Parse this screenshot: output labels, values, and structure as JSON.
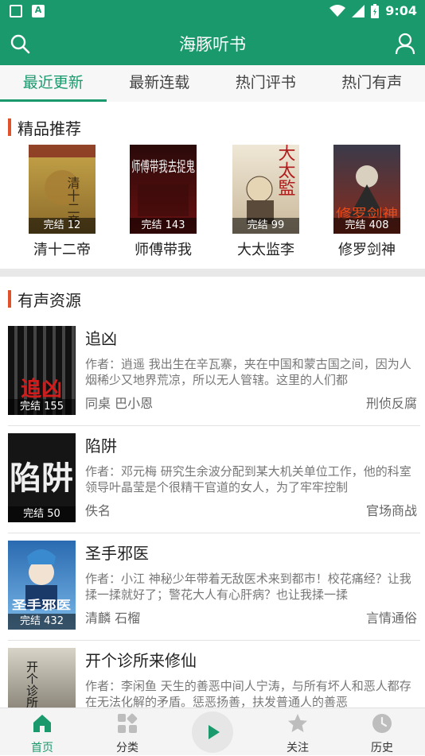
{
  "status_bar": {
    "time": "9:04"
  },
  "app": {
    "title": "海豚听书"
  },
  "tabs": [
    {
      "label": "最近更新",
      "active": true
    },
    {
      "label": "最新连载",
      "active": false
    },
    {
      "label": "热门评书",
      "active": false
    },
    {
      "label": "热门有声",
      "active": false
    }
  ],
  "featured": {
    "section_title": "精品推荐",
    "items": [
      {
        "title": "清十二帝",
        "badge": "完结 12",
        "cover_text": "清十二帝"
      },
      {
        "title": "师傅带我",
        "badge": "完结 143",
        "cover_text": "师傅带我去捉鬼"
      },
      {
        "title": "大太监李",
        "badge": "完结 99",
        "cover_text": "大太監"
      },
      {
        "title": "修罗剑神",
        "badge": "完结 408",
        "cover_text": "修罗剑神"
      }
    ]
  },
  "audio": {
    "section_title": "有声资源",
    "items": [
      {
        "title": "追凶",
        "badge": "完结 155",
        "desc": "作者：逍遥 我出生在辛瓦寨，夹在中国和蒙古国之间，因为人烟稀少又地界荒凉，所以无人管辖。这里的人们都",
        "author": "同桌 巴小恩",
        "category": "刑侦反腐",
        "cover_text": "追凶"
      },
      {
        "title": "陷阱",
        "badge": "完结 50",
        "desc": "作者：邓元梅 研究生余波分配到某大机关单位工作，他的科室领导叶晶莹是个很精干官道的女人，为了牢牢控制",
        "author": "佚名",
        "category": "官场商战",
        "cover_text": "陷阱"
      },
      {
        "title": "圣手邪医",
        "badge": "完结 432",
        "desc": "作者：小江 神秘少年带着无敌医术来到都市！校花痛经？让我揉一揉就好了；警花大人有心肝病？也让我揉一揉",
        "author": "清麟 石榴",
        "category": "言情通俗",
        "cover_text": "圣手邪医"
      },
      {
        "title": "开个诊所来修仙",
        "badge": "",
        "desc": "作者：李闲鱼 天生的善恶中间人宁涛，与所有坏人和恶人都存在无法化解的矛盾。惩恶扬善，扶发普通人的善恶",
        "author": "",
        "category": "",
        "cover_text": "开个诊所来修仙"
      }
    ]
  },
  "bottom_nav": [
    {
      "label": "首页",
      "icon": "home-icon",
      "active": true
    },
    {
      "label": "分类",
      "icon": "category-icon",
      "active": false
    },
    {
      "label": "",
      "icon": "play-icon",
      "active": false
    },
    {
      "label": "关注",
      "icon": "star-icon",
      "active": false
    },
    {
      "label": "历史",
      "icon": "clock-icon",
      "active": false
    }
  ],
  "colors": {
    "primary": "#1a9a6c",
    "accent_bar": "#e0532a"
  }
}
